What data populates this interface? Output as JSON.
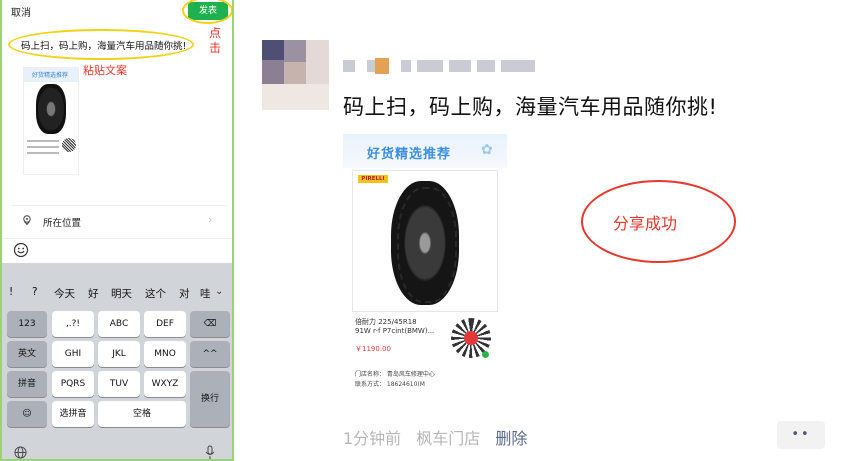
{
  "phone": {
    "cancel_label": "取消",
    "publish_label": "发表",
    "tap_hint": "点击",
    "post_text": "码上扫，码上购，海量汽车用品随你挑!",
    "paste_hint": "粘贴文案",
    "thumb_banner": "好货精选推荐",
    "location_label": "所在位置",
    "location_chevron": "›",
    "keyboard": {
      "suggestions": [
        "!",
        "?",
        "今天",
        "好",
        "明天",
        "这个",
        "对",
        "哇"
      ],
      "collapse": "⌄",
      "row1": [
        "123",
        ",.?!",
        "ABC",
        "DEF",
        "⌫"
      ],
      "row2": [
        "英文",
        "GHI",
        "JKL",
        "MNO",
        "^^"
      ],
      "row3": [
        "拼音",
        "PQRS",
        "TUV",
        "WXYZ"
      ],
      "row4": [
        "☺",
        "选拼音",
        "空格"
      ],
      "newline": "换行"
    }
  },
  "post": {
    "text": "码上扫，码上购，海量汽车用品随你挑!",
    "card": {
      "banner": "好货精选推荐",
      "brand": "PIRELLI",
      "product_name_line1": "倍耐力 225/45R18",
      "product_name_line2": "91W r-f P7cint(BMW)...",
      "price": "￥1190.00",
      "store_line1": "门店名称：   青岛风车修理中心",
      "store_line2": "联系方式：   18624610(M"
    },
    "success_note": "分享成功",
    "time": "1分钟前",
    "source": "枫车门店",
    "delete_label": "删除",
    "more_label": "••"
  }
}
